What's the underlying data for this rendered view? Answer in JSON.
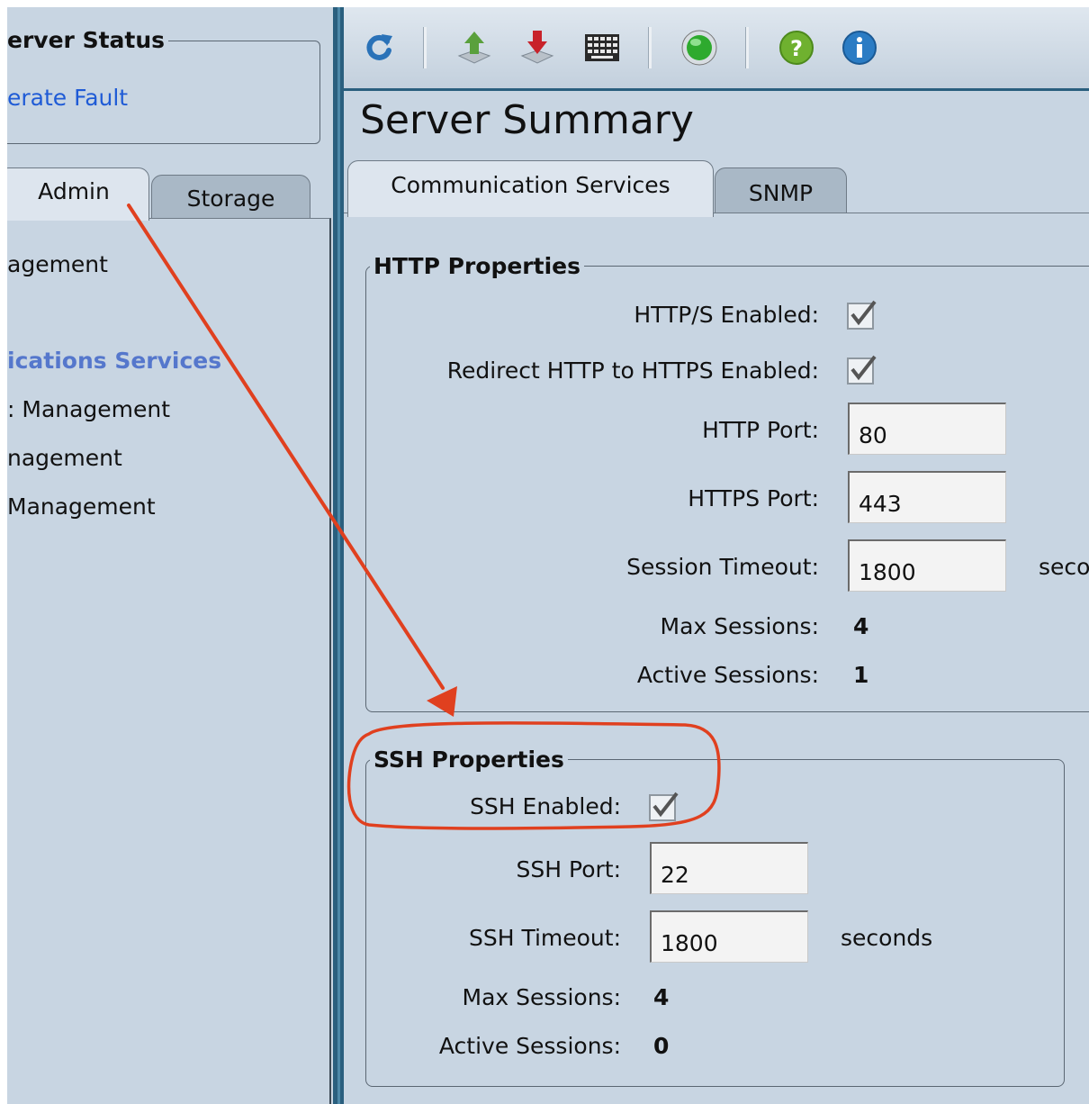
{
  "server_status": {
    "title": "erver Status",
    "link": "erate Fault"
  },
  "left_tabs": {
    "admin": "Admin",
    "storage": "Storage"
  },
  "nav_items": [
    "agement",
    "ications Services",
    ": Management",
    "nagement",
    " Management"
  ],
  "toolbar": {
    "icons": [
      "refresh-icon",
      "upload-icon",
      "download-icon",
      "keyboard-icon",
      "status-globe-icon",
      "help-icon",
      "info-icon"
    ],
    "colors": {
      "refresh": "#2a72b8",
      "upload": "#5aa03c",
      "download": "#c8222a",
      "globe": "#2eaa2e",
      "help": "#6fb12f",
      "info": "#2b7cc4"
    }
  },
  "page_title": "Server Summary",
  "tabs": {
    "communication_services": "Communication Services",
    "snmp": "SNMP"
  },
  "http": {
    "legend": "HTTP Properties",
    "https_enabled_label": "HTTP/S Enabled:",
    "https_enabled": true,
    "redirect_label": "Redirect HTTP to HTTPS Enabled:",
    "redirect_enabled": true,
    "http_port_label": "HTTP Port:",
    "http_port": "80",
    "https_port_label": "HTTPS Port:",
    "https_port": "443",
    "session_timeout_label": "Session Timeout:",
    "session_timeout": "1800",
    "session_timeout_unit": "seco",
    "max_sessions_label": "Max Sessions:",
    "max_sessions": "4",
    "active_sessions_label": "Active Sessions:",
    "active_sessions": "1"
  },
  "ssh": {
    "legend": "SSH Properties",
    "enabled_label": "SSH Enabled:",
    "enabled": true,
    "port_label": "SSH Port:",
    "port": "22",
    "timeout_label": "SSH Timeout:",
    "timeout": "1800",
    "timeout_unit": "seconds",
    "max_sessions_label": "Max Sessions:",
    "max_sessions": "4",
    "active_sessions_label": "Active Sessions:",
    "active_sessions": "0"
  },
  "annotation_color": "#e0401f"
}
